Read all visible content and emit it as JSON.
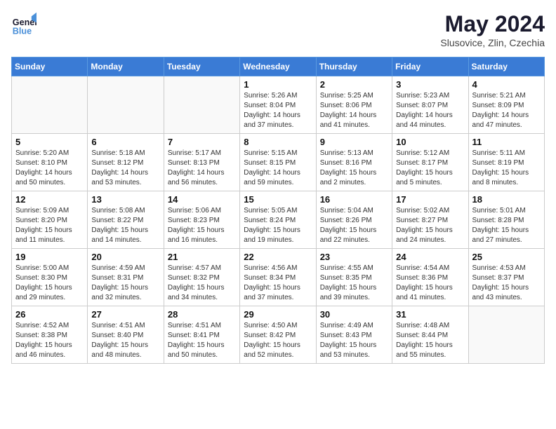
{
  "header": {
    "logo_line1": "General",
    "logo_line2": "Blue",
    "month": "May 2024",
    "location": "Slusovice, Zlin, Czechia"
  },
  "weekdays": [
    "Sunday",
    "Monday",
    "Tuesday",
    "Wednesday",
    "Thursday",
    "Friday",
    "Saturday"
  ],
  "weeks": [
    [
      {
        "day": "",
        "text": ""
      },
      {
        "day": "",
        "text": ""
      },
      {
        "day": "",
        "text": ""
      },
      {
        "day": "1",
        "text": "Sunrise: 5:26 AM\nSunset: 8:04 PM\nDaylight: 14 hours\nand 37 minutes."
      },
      {
        "day": "2",
        "text": "Sunrise: 5:25 AM\nSunset: 8:06 PM\nDaylight: 14 hours\nand 41 minutes."
      },
      {
        "day": "3",
        "text": "Sunrise: 5:23 AM\nSunset: 8:07 PM\nDaylight: 14 hours\nand 44 minutes."
      },
      {
        "day": "4",
        "text": "Sunrise: 5:21 AM\nSunset: 8:09 PM\nDaylight: 14 hours\nand 47 minutes."
      }
    ],
    [
      {
        "day": "5",
        "text": "Sunrise: 5:20 AM\nSunset: 8:10 PM\nDaylight: 14 hours\nand 50 minutes."
      },
      {
        "day": "6",
        "text": "Sunrise: 5:18 AM\nSunset: 8:12 PM\nDaylight: 14 hours\nand 53 minutes."
      },
      {
        "day": "7",
        "text": "Sunrise: 5:17 AM\nSunset: 8:13 PM\nDaylight: 14 hours\nand 56 minutes."
      },
      {
        "day": "8",
        "text": "Sunrise: 5:15 AM\nSunset: 8:15 PM\nDaylight: 14 hours\nand 59 minutes."
      },
      {
        "day": "9",
        "text": "Sunrise: 5:13 AM\nSunset: 8:16 PM\nDaylight: 15 hours\nand 2 minutes."
      },
      {
        "day": "10",
        "text": "Sunrise: 5:12 AM\nSunset: 8:17 PM\nDaylight: 15 hours\nand 5 minutes."
      },
      {
        "day": "11",
        "text": "Sunrise: 5:11 AM\nSunset: 8:19 PM\nDaylight: 15 hours\nand 8 minutes."
      }
    ],
    [
      {
        "day": "12",
        "text": "Sunrise: 5:09 AM\nSunset: 8:20 PM\nDaylight: 15 hours\nand 11 minutes."
      },
      {
        "day": "13",
        "text": "Sunrise: 5:08 AM\nSunset: 8:22 PM\nDaylight: 15 hours\nand 14 minutes."
      },
      {
        "day": "14",
        "text": "Sunrise: 5:06 AM\nSunset: 8:23 PM\nDaylight: 15 hours\nand 16 minutes."
      },
      {
        "day": "15",
        "text": "Sunrise: 5:05 AM\nSunset: 8:24 PM\nDaylight: 15 hours\nand 19 minutes."
      },
      {
        "day": "16",
        "text": "Sunrise: 5:04 AM\nSunset: 8:26 PM\nDaylight: 15 hours\nand 22 minutes."
      },
      {
        "day": "17",
        "text": "Sunrise: 5:02 AM\nSunset: 8:27 PM\nDaylight: 15 hours\nand 24 minutes."
      },
      {
        "day": "18",
        "text": "Sunrise: 5:01 AM\nSunset: 8:28 PM\nDaylight: 15 hours\nand 27 minutes."
      }
    ],
    [
      {
        "day": "19",
        "text": "Sunrise: 5:00 AM\nSunset: 8:30 PM\nDaylight: 15 hours\nand 29 minutes."
      },
      {
        "day": "20",
        "text": "Sunrise: 4:59 AM\nSunset: 8:31 PM\nDaylight: 15 hours\nand 32 minutes."
      },
      {
        "day": "21",
        "text": "Sunrise: 4:57 AM\nSunset: 8:32 PM\nDaylight: 15 hours\nand 34 minutes."
      },
      {
        "day": "22",
        "text": "Sunrise: 4:56 AM\nSunset: 8:34 PM\nDaylight: 15 hours\nand 37 minutes."
      },
      {
        "day": "23",
        "text": "Sunrise: 4:55 AM\nSunset: 8:35 PM\nDaylight: 15 hours\nand 39 minutes."
      },
      {
        "day": "24",
        "text": "Sunrise: 4:54 AM\nSunset: 8:36 PM\nDaylight: 15 hours\nand 41 minutes."
      },
      {
        "day": "25",
        "text": "Sunrise: 4:53 AM\nSunset: 8:37 PM\nDaylight: 15 hours\nand 43 minutes."
      }
    ],
    [
      {
        "day": "26",
        "text": "Sunrise: 4:52 AM\nSunset: 8:38 PM\nDaylight: 15 hours\nand 46 minutes."
      },
      {
        "day": "27",
        "text": "Sunrise: 4:51 AM\nSunset: 8:40 PM\nDaylight: 15 hours\nand 48 minutes."
      },
      {
        "day": "28",
        "text": "Sunrise: 4:51 AM\nSunset: 8:41 PM\nDaylight: 15 hours\nand 50 minutes."
      },
      {
        "day": "29",
        "text": "Sunrise: 4:50 AM\nSunset: 8:42 PM\nDaylight: 15 hours\nand 52 minutes."
      },
      {
        "day": "30",
        "text": "Sunrise: 4:49 AM\nSunset: 8:43 PM\nDaylight: 15 hours\nand 53 minutes."
      },
      {
        "day": "31",
        "text": "Sunrise: 4:48 AM\nSunset: 8:44 PM\nDaylight: 15 hours\nand 55 minutes."
      },
      {
        "day": "",
        "text": ""
      }
    ]
  ]
}
